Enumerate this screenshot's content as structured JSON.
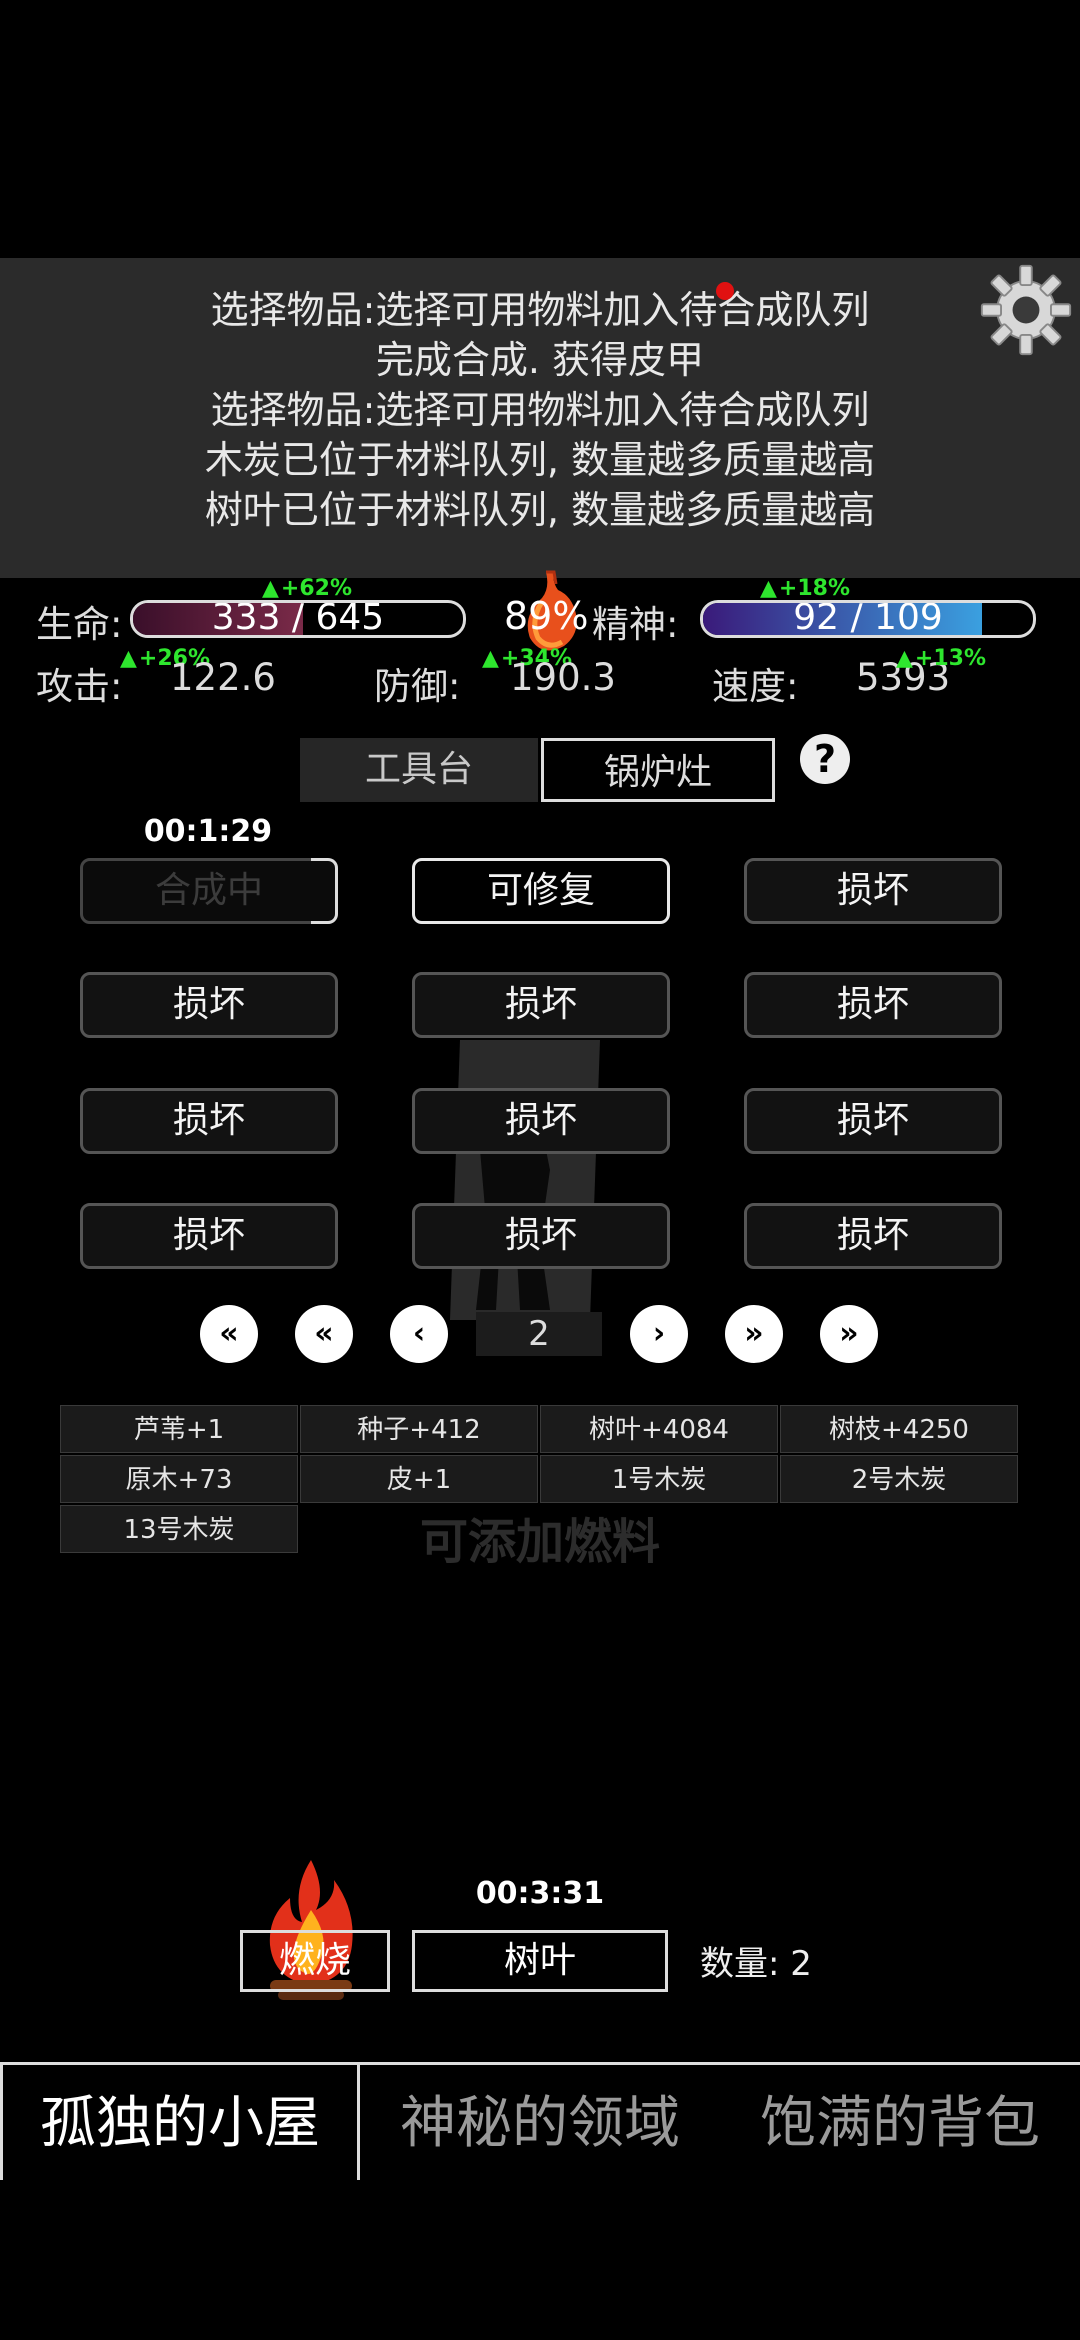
{
  "log": {
    "lines": [
      "选择物品:选择可用物料加入待合成队列",
      "完成合成. 获得皮甲",
      "选择物品:选择可用物料加入待合成队列",
      "木炭已位于材料队列, 数量越多质量越高",
      "树叶已位于材料队列, 数量越多质量越高"
    ]
  },
  "stats": {
    "life_label": "生命:",
    "life_value": "333 / 645",
    "life_fraction": 0.516,
    "life_boost": "+62%",
    "hunger_percent": "89%",
    "spirit_label": "精神:",
    "spirit_value": "92 / 109",
    "spirit_fraction": 0.844,
    "spirit_boost": "+18%",
    "attack_label": "攻击:",
    "attack_value": "122.6",
    "attack_boost": "+26%",
    "defense_label": "防御:",
    "defense_value": "190.3",
    "defense_boost": "+34%",
    "speed_label": "速度:",
    "speed_value": "5393",
    "speed_boost": "+13%"
  },
  "tabs": {
    "workbench": "工具台",
    "furnace": "锅炉灶",
    "help": "?"
  },
  "craft": {
    "timer": "00:1:29",
    "slots": [
      "合成中",
      "可修复",
      "损坏",
      "损坏",
      "损坏",
      "损坏",
      "损坏",
      "损坏",
      "损坏",
      "损坏",
      "损坏",
      "损坏"
    ]
  },
  "pager": {
    "page": "2",
    "first": "«",
    "prev_fast": "«",
    "prev": "‹",
    "next": "›",
    "next_fast": "»",
    "last": "»"
  },
  "materials": [
    "芦苇+1",
    "种子+412",
    "树叶+4084",
    "树枝+4250",
    "原木+73",
    "皮+1",
    "1号木炭",
    "2号木炭",
    "13号木炭"
  ],
  "fuel": {
    "hint": "可添加燃料",
    "timer": "00:3:31",
    "burn_label": "燃烧",
    "fuel_item": "树叶",
    "quantity": "数量: 2"
  },
  "nav": {
    "cabin": "孤独的小屋",
    "domain": "神秘的领域",
    "backpack": "饱满的背包"
  },
  "colors": {
    "life_bar": "#6a1a3a",
    "spirit_bar_start": "#3a1a7a",
    "spirit_bar_end": "#3aa0e0",
    "boost": "#2ee62e",
    "notify": "#e11111"
  }
}
